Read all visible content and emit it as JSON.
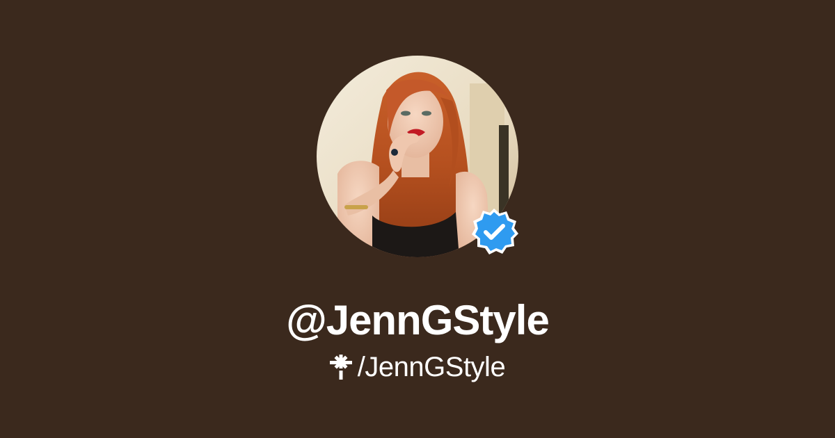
{
  "profile": {
    "username": "@JennGStyle",
    "link_path": "/JennGStyle",
    "avatar_icon": "profile-photo",
    "verified_icon": "verified-check-icon",
    "link_icon": "linktree-asterisk-icon"
  },
  "colors": {
    "background": "#3b291d",
    "text": "#ffffff",
    "verified_badge": "#2f9bf0"
  }
}
